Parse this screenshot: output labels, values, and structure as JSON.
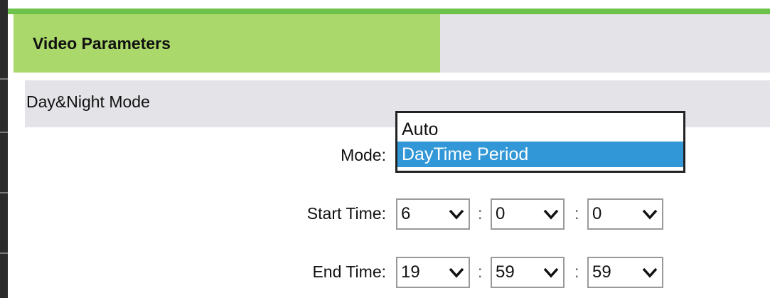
{
  "header": {
    "title": "Video Parameters"
  },
  "section": {
    "title": "Day&Night Mode"
  },
  "mode": {
    "label": "Mode:",
    "options": [
      "Auto",
      "DayTime Period"
    ],
    "highlighted": "DayTime Period"
  },
  "start_time": {
    "label": "Start Time:",
    "hour": "6",
    "minute": "0",
    "second": "0"
  },
  "end_time": {
    "label": "End Time:",
    "hour": "19",
    "minute": "59",
    "second": "59"
  },
  "separator": ":",
  "colors": {
    "accent": "#6cc24a",
    "tab": "#abd86a",
    "highlight": "#3197d6",
    "panel": "#e3e3e8"
  },
  "icons": {
    "select_arrow": "chevron-down-icon"
  }
}
